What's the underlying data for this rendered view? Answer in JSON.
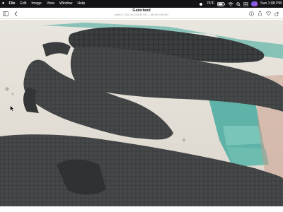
{
  "menubar": {
    "apple_icon": "apple-logo-icon",
    "items": [
      {
        "label": "File",
        "app": true
      },
      {
        "label": "Edit"
      },
      {
        "label": "Image"
      },
      {
        "label": "View"
      },
      {
        "label": "Window"
      },
      {
        "label": "Help"
      }
    ],
    "temperature": "76°F",
    "clock": "Sun 1:08 PM",
    "status_icons": [
      "weather-icon",
      "battery-icon",
      "wifi-icon",
      "search-icon",
      "control-center-icon",
      "siri-icon"
    ]
  },
  "toolbar": {
    "title": "Gatorland",
    "subtitle": "March 3, 2024 at 11:04:49 PM  —  84,008 of 84,584",
    "left_icons": [
      "sidebar-icon",
      "back-chevron-icon"
    ],
    "right_icons": [
      "info-icon",
      "share-icon",
      "heart-icon",
      "rotate-icon"
    ]
  },
  "photo": {
    "subject": "alligators",
    "water_color": "#5fb2a7",
    "sand_color": "#e9e6df",
    "gator_color": "#3a3c3d"
  }
}
